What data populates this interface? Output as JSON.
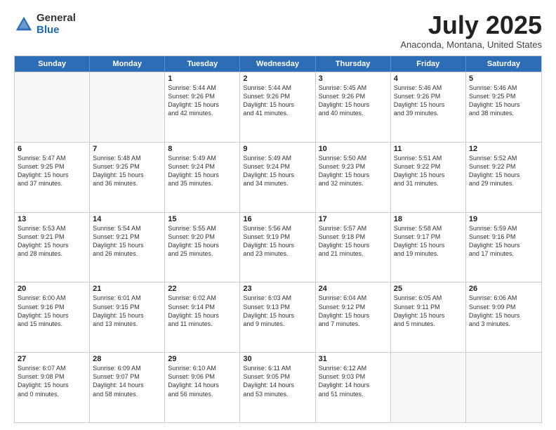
{
  "logo": {
    "general": "General",
    "blue": "Blue"
  },
  "title": "July 2025",
  "location": "Anaconda, Montana, United States",
  "days_of_week": [
    "Sunday",
    "Monday",
    "Tuesday",
    "Wednesday",
    "Thursday",
    "Friday",
    "Saturday"
  ],
  "weeks": [
    [
      {
        "day": "",
        "empty": true
      },
      {
        "day": "",
        "empty": true
      },
      {
        "day": "1",
        "info": "Sunrise: 5:44 AM\nSunset: 9:26 PM\nDaylight: 15 hours\nand 42 minutes."
      },
      {
        "day": "2",
        "info": "Sunrise: 5:44 AM\nSunset: 9:26 PM\nDaylight: 15 hours\nand 41 minutes."
      },
      {
        "day": "3",
        "info": "Sunrise: 5:45 AM\nSunset: 9:26 PM\nDaylight: 15 hours\nand 40 minutes."
      },
      {
        "day": "4",
        "info": "Sunrise: 5:46 AM\nSunset: 9:26 PM\nDaylight: 15 hours\nand 39 minutes."
      },
      {
        "day": "5",
        "info": "Sunrise: 5:46 AM\nSunset: 9:25 PM\nDaylight: 15 hours\nand 38 minutes."
      }
    ],
    [
      {
        "day": "6",
        "info": "Sunrise: 5:47 AM\nSunset: 9:25 PM\nDaylight: 15 hours\nand 37 minutes."
      },
      {
        "day": "7",
        "info": "Sunrise: 5:48 AM\nSunset: 9:25 PM\nDaylight: 15 hours\nand 36 minutes."
      },
      {
        "day": "8",
        "info": "Sunrise: 5:49 AM\nSunset: 9:24 PM\nDaylight: 15 hours\nand 35 minutes."
      },
      {
        "day": "9",
        "info": "Sunrise: 5:49 AM\nSunset: 9:24 PM\nDaylight: 15 hours\nand 34 minutes."
      },
      {
        "day": "10",
        "info": "Sunrise: 5:50 AM\nSunset: 9:23 PM\nDaylight: 15 hours\nand 32 minutes."
      },
      {
        "day": "11",
        "info": "Sunrise: 5:51 AM\nSunset: 9:22 PM\nDaylight: 15 hours\nand 31 minutes."
      },
      {
        "day": "12",
        "info": "Sunrise: 5:52 AM\nSunset: 9:22 PM\nDaylight: 15 hours\nand 29 minutes."
      }
    ],
    [
      {
        "day": "13",
        "info": "Sunrise: 5:53 AM\nSunset: 9:21 PM\nDaylight: 15 hours\nand 28 minutes."
      },
      {
        "day": "14",
        "info": "Sunrise: 5:54 AM\nSunset: 9:21 PM\nDaylight: 15 hours\nand 26 minutes."
      },
      {
        "day": "15",
        "info": "Sunrise: 5:55 AM\nSunset: 9:20 PM\nDaylight: 15 hours\nand 25 minutes."
      },
      {
        "day": "16",
        "info": "Sunrise: 5:56 AM\nSunset: 9:19 PM\nDaylight: 15 hours\nand 23 minutes."
      },
      {
        "day": "17",
        "info": "Sunrise: 5:57 AM\nSunset: 9:18 PM\nDaylight: 15 hours\nand 21 minutes."
      },
      {
        "day": "18",
        "info": "Sunrise: 5:58 AM\nSunset: 9:17 PM\nDaylight: 15 hours\nand 19 minutes."
      },
      {
        "day": "19",
        "info": "Sunrise: 5:59 AM\nSunset: 9:16 PM\nDaylight: 15 hours\nand 17 minutes."
      }
    ],
    [
      {
        "day": "20",
        "info": "Sunrise: 6:00 AM\nSunset: 9:16 PM\nDaylight: 15 hours\nand 15 minutes."
      },
      {
        "day": "21",
        "info": "Sunrise: 6:01 AM\nSunset: 9:15 PM\nDaylight: 15 hours\nand 13 minutes."
      },
      {
        "day": "22",
        "info": "Sunrise: 6:02 AM\nSunset: 9:14 PM\nDaylight: 15 hours\nand 11 minutes."
      },
      {
        "day": "23",
        "info": "Sunrise: 6:03 AM\nSunset: 9:13 PM\nDaylight: 15 hours\nand 9 minutes."
      },
      {
        "day": "24",
        "info": "Sunrise: 6:04 AM\nSunset: 9:12 PM\nDaylight: 15 hours\nand 7 minutes."
      },
      {
        "day": "25",
        "info": "Sunrise: 6:05 AM\nSunset: 9:11 PM\nDaylight: 15 hours\nand 5 minutes."
      },
      {
        "day": "26",
        "info": "Sunrise: 6:06 AM\nSunset: 9:09 PM\nDaylight: 15 hours\nand 3 minutes."
      }
    ],
    [
      {
        "day": "27",
        "info": "Sunrise: 6:07 AM\nSunset: 9:08 PM\nDaylight: 15 hours\nand 0 minutes."
      },
      {
        "day": "28",
        "info": "Sunrise: 6:09 AM\nSunset: 9:07 PM\nDaylight: 14 hours\nand 58 minutes."
      },
      {
        "day": "29",
        "info": "Sunrise: 6:10 AM\nSunset: 9:06 PM\nDaylight: 14 hours\nand 56 minutes."
      },
      {
        "day": "30",
        "info": "Sunrise: 6:11 AM\nSunset: 9:05 PM\nDaylight: 14 hours\nand 53 minutes."
      },
      {
        "day": "31",
        "info": "Sunrise: 6:12 AM\nSunset: 9:03 PM\nDaylight: 14 hours\nand 51 minutes."
      },
      {
        "day": "",
        "empty": true
      },
      {
        "day": "",
        "empty": true
      }
    ]
  ]
}
